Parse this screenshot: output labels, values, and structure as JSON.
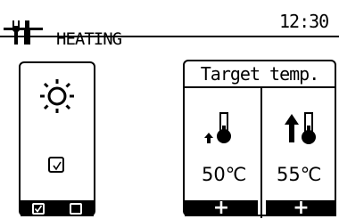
{
  "header": {
    "mode_label": "HEATING",
    "clock": "12:30",
    "icon": "wrench-screwdriver-icon"
  },
  "left_panel": {
    "icon": "sun-icon",
    "checkbox_checked": true,
    "bottom_checkboxes": [
      {
        "checked": true
      },
      {
        "checked": false
      }
    ]
  },
  "right_panel": {
    "title": "Target temp.",
    "zones": [
      {
        "icon": "thermometer-small-arrow-icon",
        "temp": "50℃",
        "button": "+"
      },
      {
        "icon": "thermometer-large-arrow-icon",
        "temp": "55℃",
        "button": "+"
      }
    ]
  }
}
